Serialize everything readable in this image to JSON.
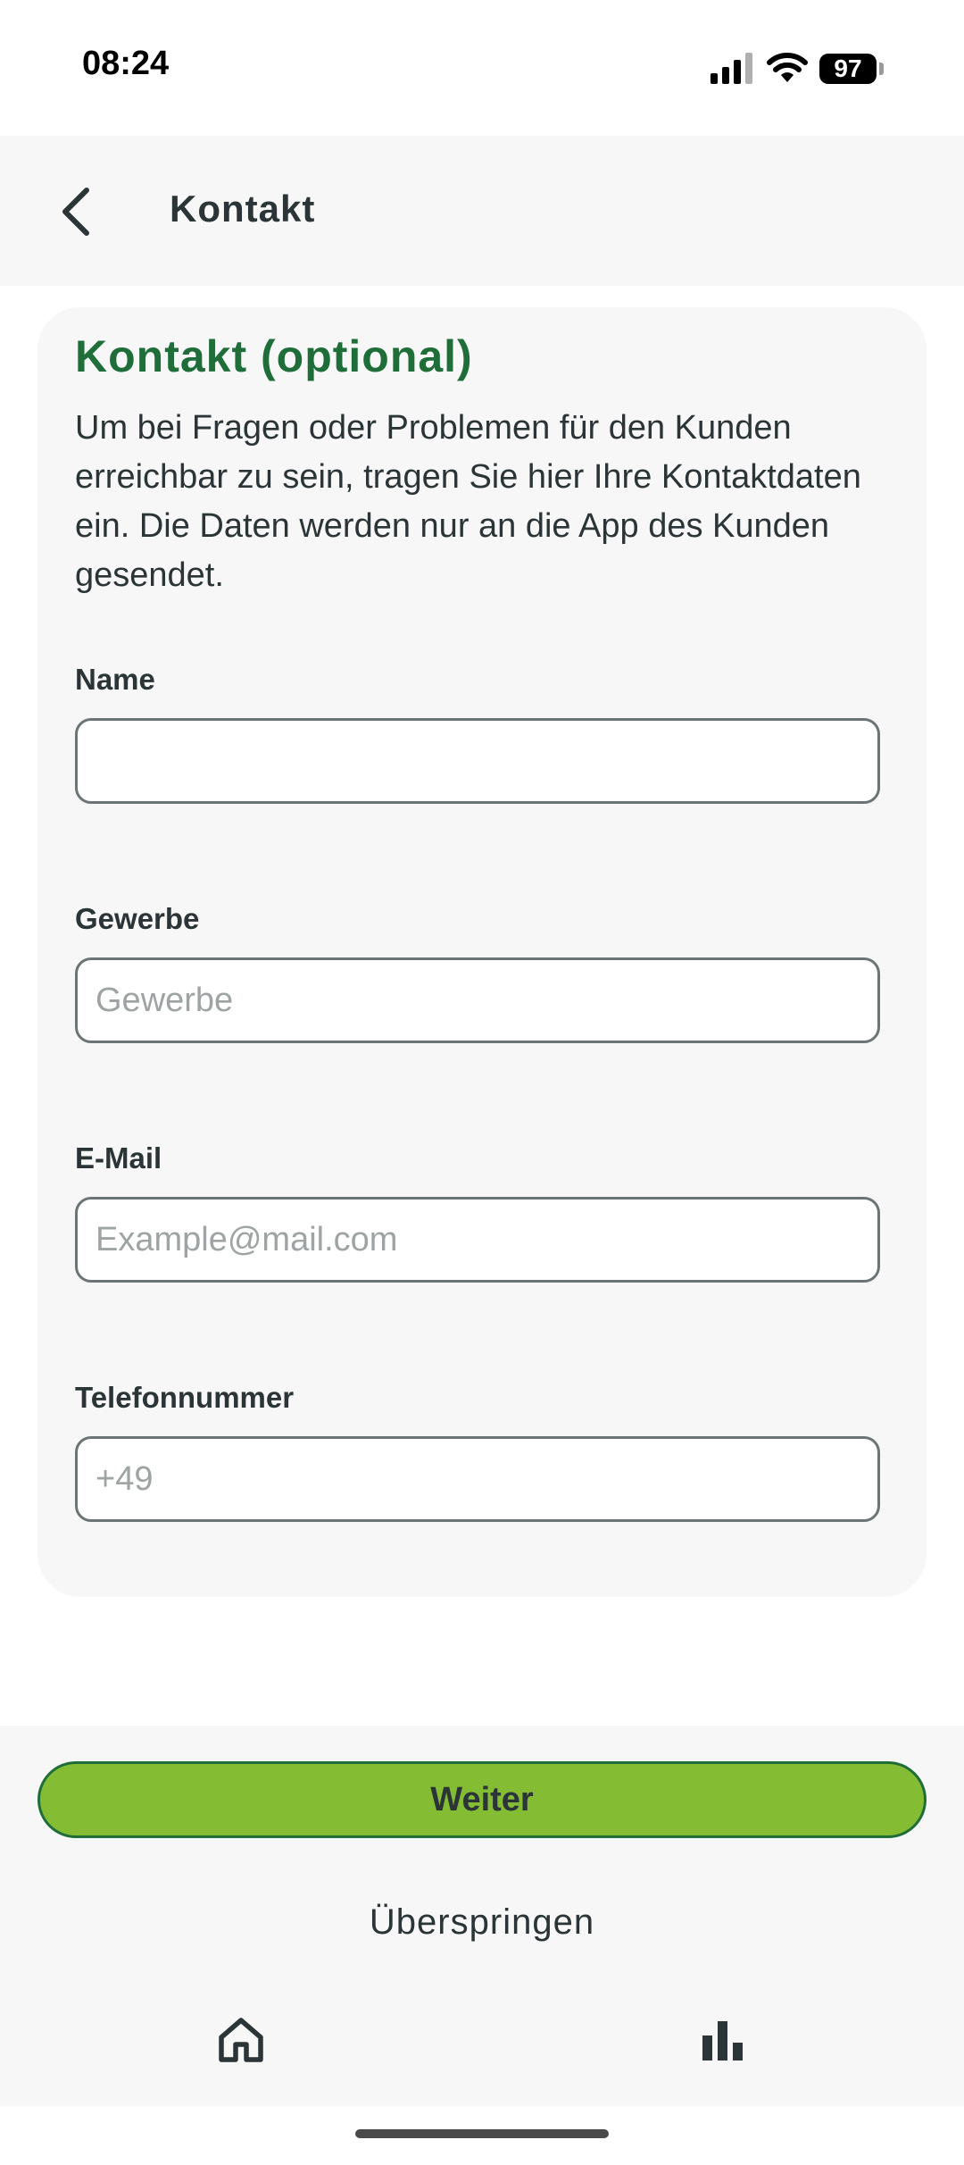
{
  "status_bar": {
    "time": "08:24",
    "battery": "97",
    "icons": [
      "signal-icon",
      "wifi-icon",
      "battery-icon"
    ]
  },
  "header": {
    "title": "Kontakt",
    "back_icon": "chevron-left-icon"
  },
  "card": {
    "title": "Kontakt (optional)",
    "description": "Um bei Fragen oder Problemen für den Kunden erreichbar zu sein, tragen Sie hier Ihre Kontaktdaten ein. Die Daten werden nur an die App des Kunden gesendet.",
    "fields": [
      {
        "label": "Name",
        "value": "",
        "placeholder": ""
      },
      {
        "label": "Gewerbe",
        "value": "",
        "placeholder": "Gewerbe"
      },
      {
        "label": "E-Mail",
        "value": "",
        "placeholder": "Example@mail.com"
      },
      {
        "label": "Telefonnummer",
        "value": "",
        "placeholder": "+49"
      }
    ]
  },
  "actions": {
    "primary_label": "Weiter",
    "skip_label": "Überspringen"
  },
  "tab_bar": {
    "items": [
      {
        "icon": "home-icon"
      },
      {
        "icon": "bar-chart-icon"
      }
    ]
  },
  "colors": {
    "accent_green": "#84bc34",
    "title_green": "#1f6e3a",
    "text": "#2b3436",
    "surface": "#f7f7f7"
  }
}
